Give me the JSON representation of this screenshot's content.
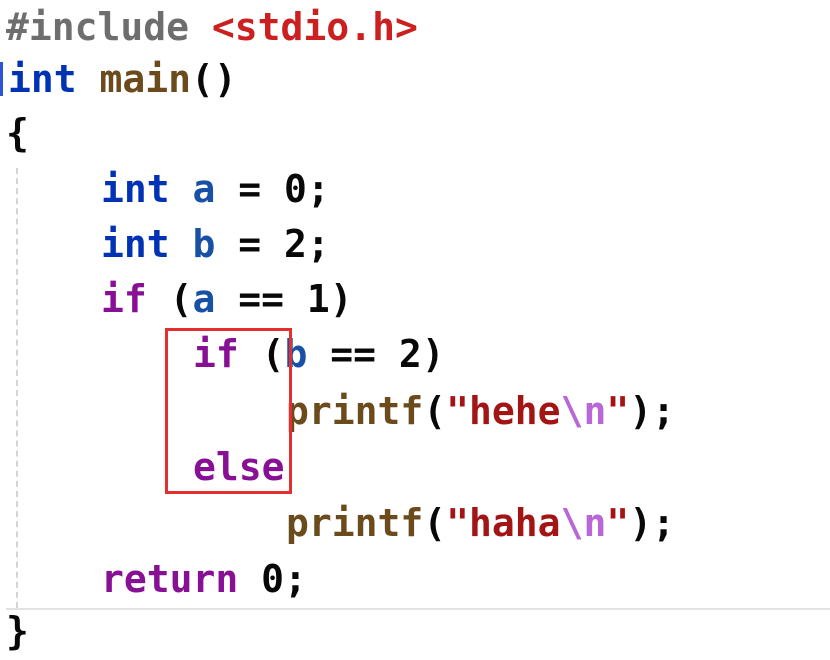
{
  "editor": {
    "lines": {
      "include": {
        "directive": "#include",
        "header": "<stdio.h>"
      },
      "main_sig": {
        "type": "int",
        "name": "main",
        "parens": "()"
      },
      "open_brace": "{",
      "decl_a": {
        "type": "int",
        "var": "a",
        "rest": " = 0;"
      },
      "decl_b": {
        "type": "int",
        "var": "b",
        "rest": " = 2;"
      },
      "if_outer": {
        "keyword": "if",
        "open": " (",
        "var": "a",
        "rest": " == 1)"
      },
      "if_inner": {
        "keyword": "if",
        "open": " (",
        "var": "b",
        "rest": " == 2)"
      },
      "printf_hehe": {
        "func": "printf",
        "open": "(",
        "str": "\"hehe",
        "escape": "\\n",
        "str_end": "\"",
        "close": ");"
      },
      "else": "else",
      "printf_haha": {
        "func": "printf",
        "open": "(",
        "str": "\"haha",
        "escape": "\\n",
        "str_end": "\"",
        "close": ");"
      },
      "return_stmt": {
        "keyword": "return",
        "rest": " 0;"
      },
      "close_brace": "}"
    }
  },
  "colors": {
    "type_keyword": "#0033b3",
    "control_keyword": "#871094",
    "identifier": "#1750a5",
    "function": "#6b4a1c",
    "string": "#a31515",
    "escape": "#b866d8",
    "preprocessor": "#6e6e6e",
    "header": "#cc1f1f",
    "highlight_box": "#e32f2f"
  }
}
